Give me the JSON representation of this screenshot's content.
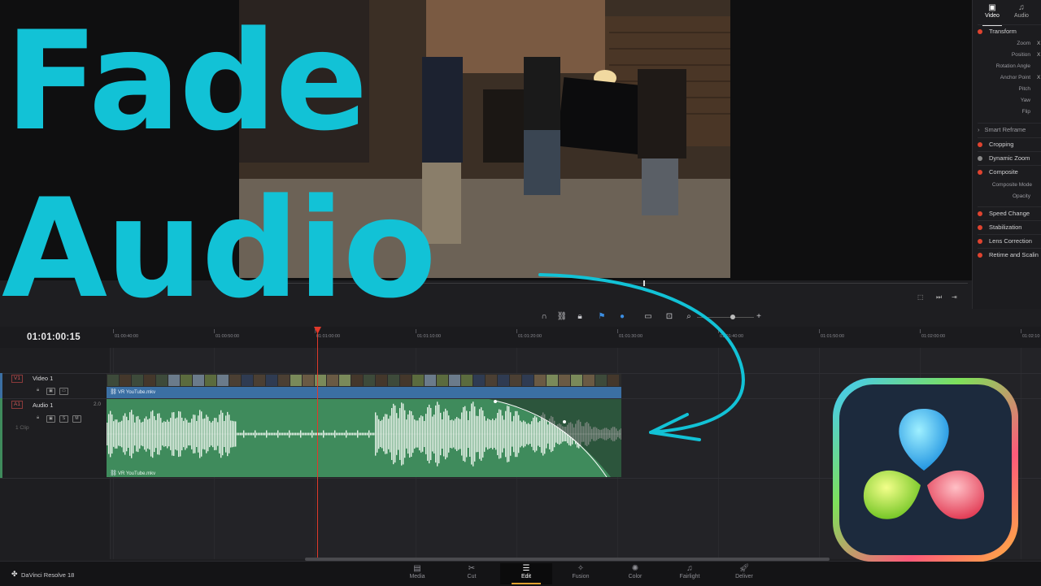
{
  "thumbnail": {
    "line1": "Fade",
    "line2": "Audio",
    "text_color": "#12c2d6"
  },
  "inspector": {
    "tabs": [
      {
        "label": "Video",
        "icon": "video-icon",
        "active": true
      },
      {
        "label": "Audio",
        "icon": "music-note-icon",
        "active": false
      }
    ],
    "transform": {
      "label": "Transform",
      "fields": [
        "Zoom",
        "Position",
        "Rotation Angle",
        "Anchor Point",
        "Pitch",
        "Yaw",
        "Flip"
      ],
      "axis": "X"
    },
    "smart_reframe": "Smart Reframe",
    "cropping": "Cropping",
    "dynamic_zoom": "Dynamic Zoom",
    "composite": {
      "label": "Composite",
      "fields": [
        "Composite Mode",
        "Opacity"
      ]
    },
    "speed_change": "Speed Change",
    "stabilization": "Stabilization",
    "lens_correction": "Lens Correction",
    "retime": "Retime and Scalin"
  },
  "timeline": {
    "timecode": "01:01:00:15",
    "ruler_ticks": [
      "01:00:40:00",
      "01:00:50:00",
      "01:01:00:00",
      "01:01:10:00",
      "01:01:20:00",
      "01:01:30:00",
      "01:01:40:00",
      "01:01:50:00",
      "01:02:00:00",
      "01:02:10"
    ],
    "video_track": {
      "badge": "V1",
      "name": "Video 1"
    },
    "audio_track": {
      "badge": "A1",
      "name": "Audio 1",
      "channels": "2.0",
      "clips": "1 Clip"
    },
    "video_clip_name": "VR YouTube.mkv",
    "audio_clip_name": "VR YouTube.mkv",
    "audio_controls": {
      "solo": "S",
      "mute": "M"
    }
  },
  "pagebar": {
    "app_name": "DaVinci Resolve 18",
    "pages": [
      {
        "label": "Media",
        "icon": "media-icon",
        "active": false
      },
      {
        "label": "Cut",
        "icon": "cut-icon",
        "active": false
      },
      {
        "label": "Edit",
        "icon": "edit-icon",
        "active": true
      },
      {
        "label": "Fusion",
        "icon": "fusion-icon",
        "active": false
      },
      {
        "label": "Color",
        "icon": "color-icon",
        "active": false
      },
      {
        "label": "Fairlight",
        "icon": "fairlight-icon",
        "active": false
      },
      {
        "label": "Deliver",
        "icon": "deliver-icon",
        "active": false
      }
    ]
  },
  "colors": {
    "playhead": "#e0392b",
    "video_clip": "#3b6fa3",
    "audio_clip": "#3f8b5c",
    "accent": "#12c2d6"
  }
}
